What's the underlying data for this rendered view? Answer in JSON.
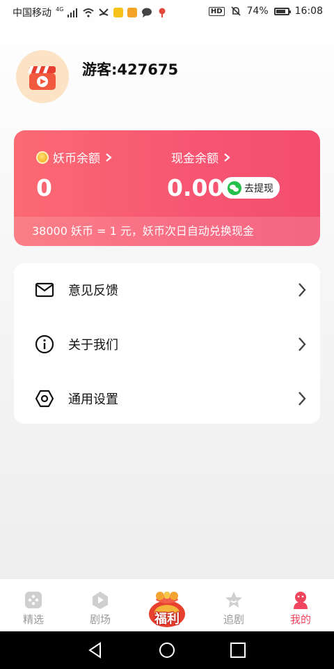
{
  "status_bar": {
    "carrier": "中国移动",
    "network": "4G",
    "battery": "74%",
    "time": "16:08",
    "hd_badge": "HD"
  },
  "profile": {
    "username": "游客:427675"
  },
  "wallet": {
    "coin_label": "妖币余额",
    "coin_value": "0",
    "cash_label": "现金余额",
    "cash_value": "0.00",
    "withdraw_button": "去提现",
    "exchange_note": "38000 妖币 = 1 元，妖币次日自动兑换现金",
    "accent_color": "#f65572"
  },
  "menu": {
    "items": [
      {
        "label": "意见反馈",
        "icon": "mail-icon"
      },
      {
        "label": "关于我们",
        "icon": "info-icon"
      },
      {
        "label": "通用设置",
        "icon": "settings-hexagon-icon"
      }
    ]
  },
  "bottom_nav": {
    "items": [
      {
        "label": "精选",
        "icon": "featured-icon"
      },
      {
        "label": "剧场",
        "icon": "play-icon"
      },
      {
        "label": "福利",
        "icon": "gift-bag-icon"
      },
      {
        "label": "追剧",
        "icon": "star-icon"
      },
      {
        "label": "我的",
        "icon": "user-icon",
        "active": true
      }
    ],
    "active_color": "#f0455e"
  }
}
